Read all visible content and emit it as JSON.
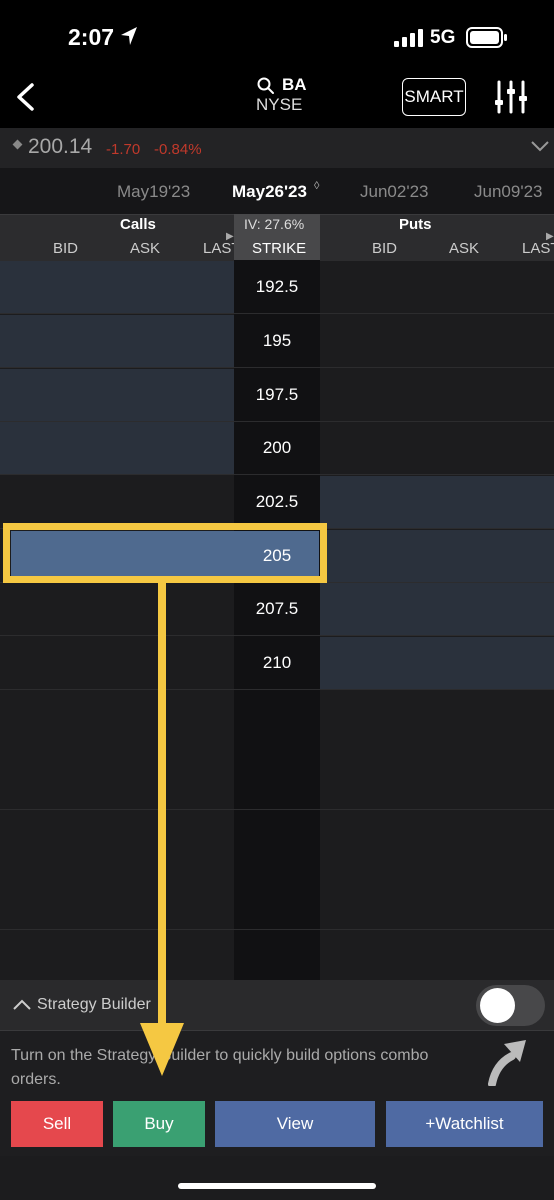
{
  "status": {
    "time": "2:07",
    "network": "5G"
  },
  "header": {
    "symbol": "BA",
    "exchange": "NYSE",
    "smart_label": "SMART"
  },
  "quote": {
    "price": "200.14",
    "change": "-1.70",
    "change_pct": "-0.84%"
  },
  "expiries": [
    "May19'23",
    "May26'23",
    "Jun02'23",
    "Jun09'23"
  ],
  "expiry_selected": "May26'23",
  "columns": {
    "calls": "Calls",
    "puts": "Puts",
    "iv": "IV: 27.6%",
    "strike": "STRIKE",
    "call_cols": [
      "BID",
      "ASK",
      "LAST"
    ],
    "put_cols": [
      "BID",
      "ASK",
      "LAST"
    ]
  },
  "strikes": [
    "192.5",
    "195",
    "197.5",
    "200",
    "202.5",
    "205",
    "207.5",
    "210"
  ],
  "selected_strike": "205",
  "strategy_builder": {
    "title": "Strategy Builder",
    "enabled": false,
    "description": "Turn on the Strategy Builder to quickly build options combo orders."
  },
  "actions": {
    "sell": "Sell",
    "buy": "Buy",
    "view": "View",
    "watchlist": "+Watchlist"
  },
  "colors": {
    "sell": "#e5484d",
    "buy": "#3aa072",
    "view": "#4f6aa3",
    "highlight": "#f5c842",
    "itm": "#2a313c"
  }
}
